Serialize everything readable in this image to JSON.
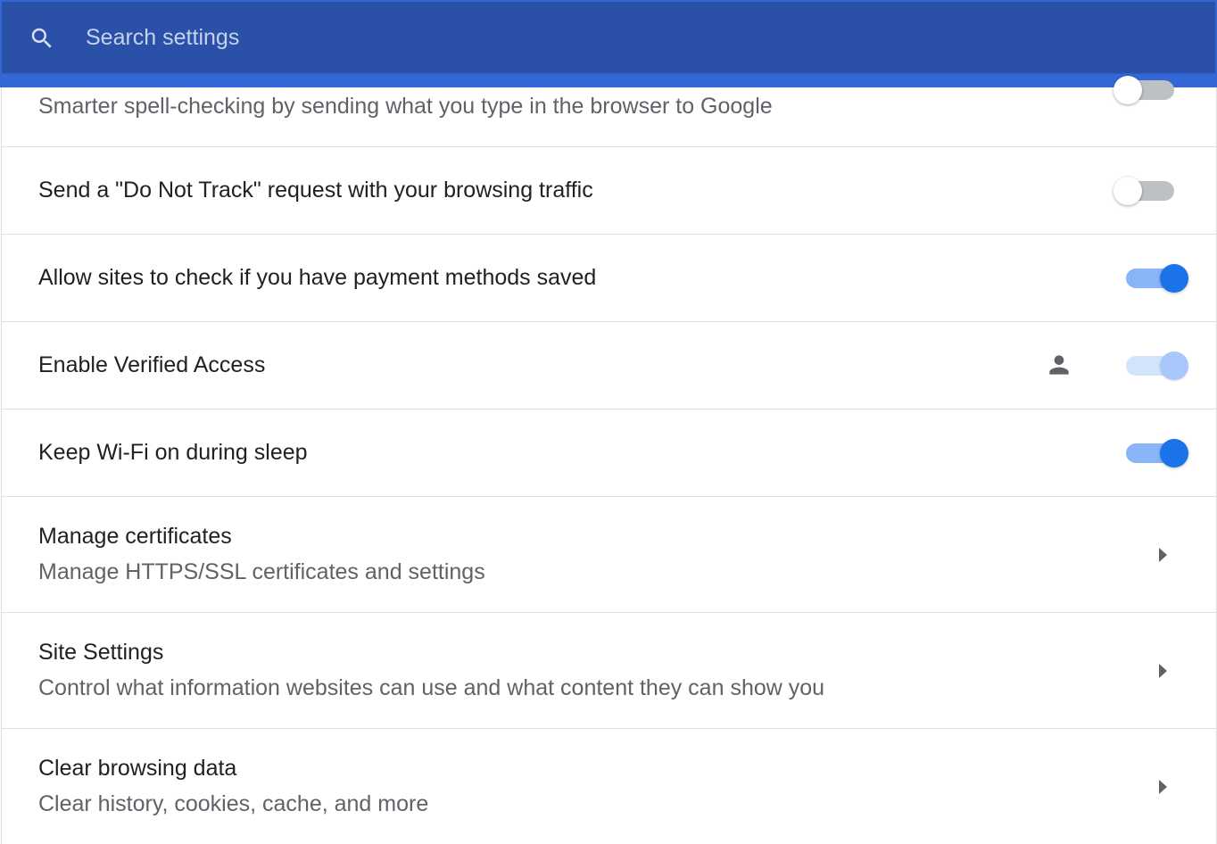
{
  "search": {
    "placeholder": "Search settings",
    "value": ""
  },
  "rows": [
    {
      "title": "",
      "subtitle": "Smarter spell-checking by sending what you type in the browser to Google",
      "control": "toggle",
      "state": "off"
    },
    {
      "title": "Send a \"Do Not Track\" request with your browsing traffic",
      "control": "toggle",
      "state": "off"
    },
    {
      "title": "Allow sites to check if you have payment methods saved",
      "control": "toggle",
      "state": "on"
    },
    {
      "title": "Enable Verified Access",
      "control": "toggle",
      "state": "on-disabled",
      "policy_icon": "person-icon"
    },
    {
      "title": "Keep Wi-Fi on during sleep",
      "control": "toggle",
      "state": "on"
    },
    {
      "title": "Manage certificates",
      "subtitle": "Manage HTTPS/SSL certificates and settings",
      "control": "chevron-right-icon"
    },
    {
      "title": "Site Settings",
      "subtitle": "Control what information websites can use and what content they can show you",
      "control": "chevron-right-icon"
    },
    {
      "title": "Clear browsing data",
      "subtitle": "Clear history, cookies, cache, and more",
      "control": "chevron-right-icon"
    }
  ],
  "colors": {
    "header_blue": "#3367d6",
    "search_bar": "#2a50a8",
    "toggle_on": "#1a73e8",
    "toggle_on_track": "#8ab4f8"
  }
}
